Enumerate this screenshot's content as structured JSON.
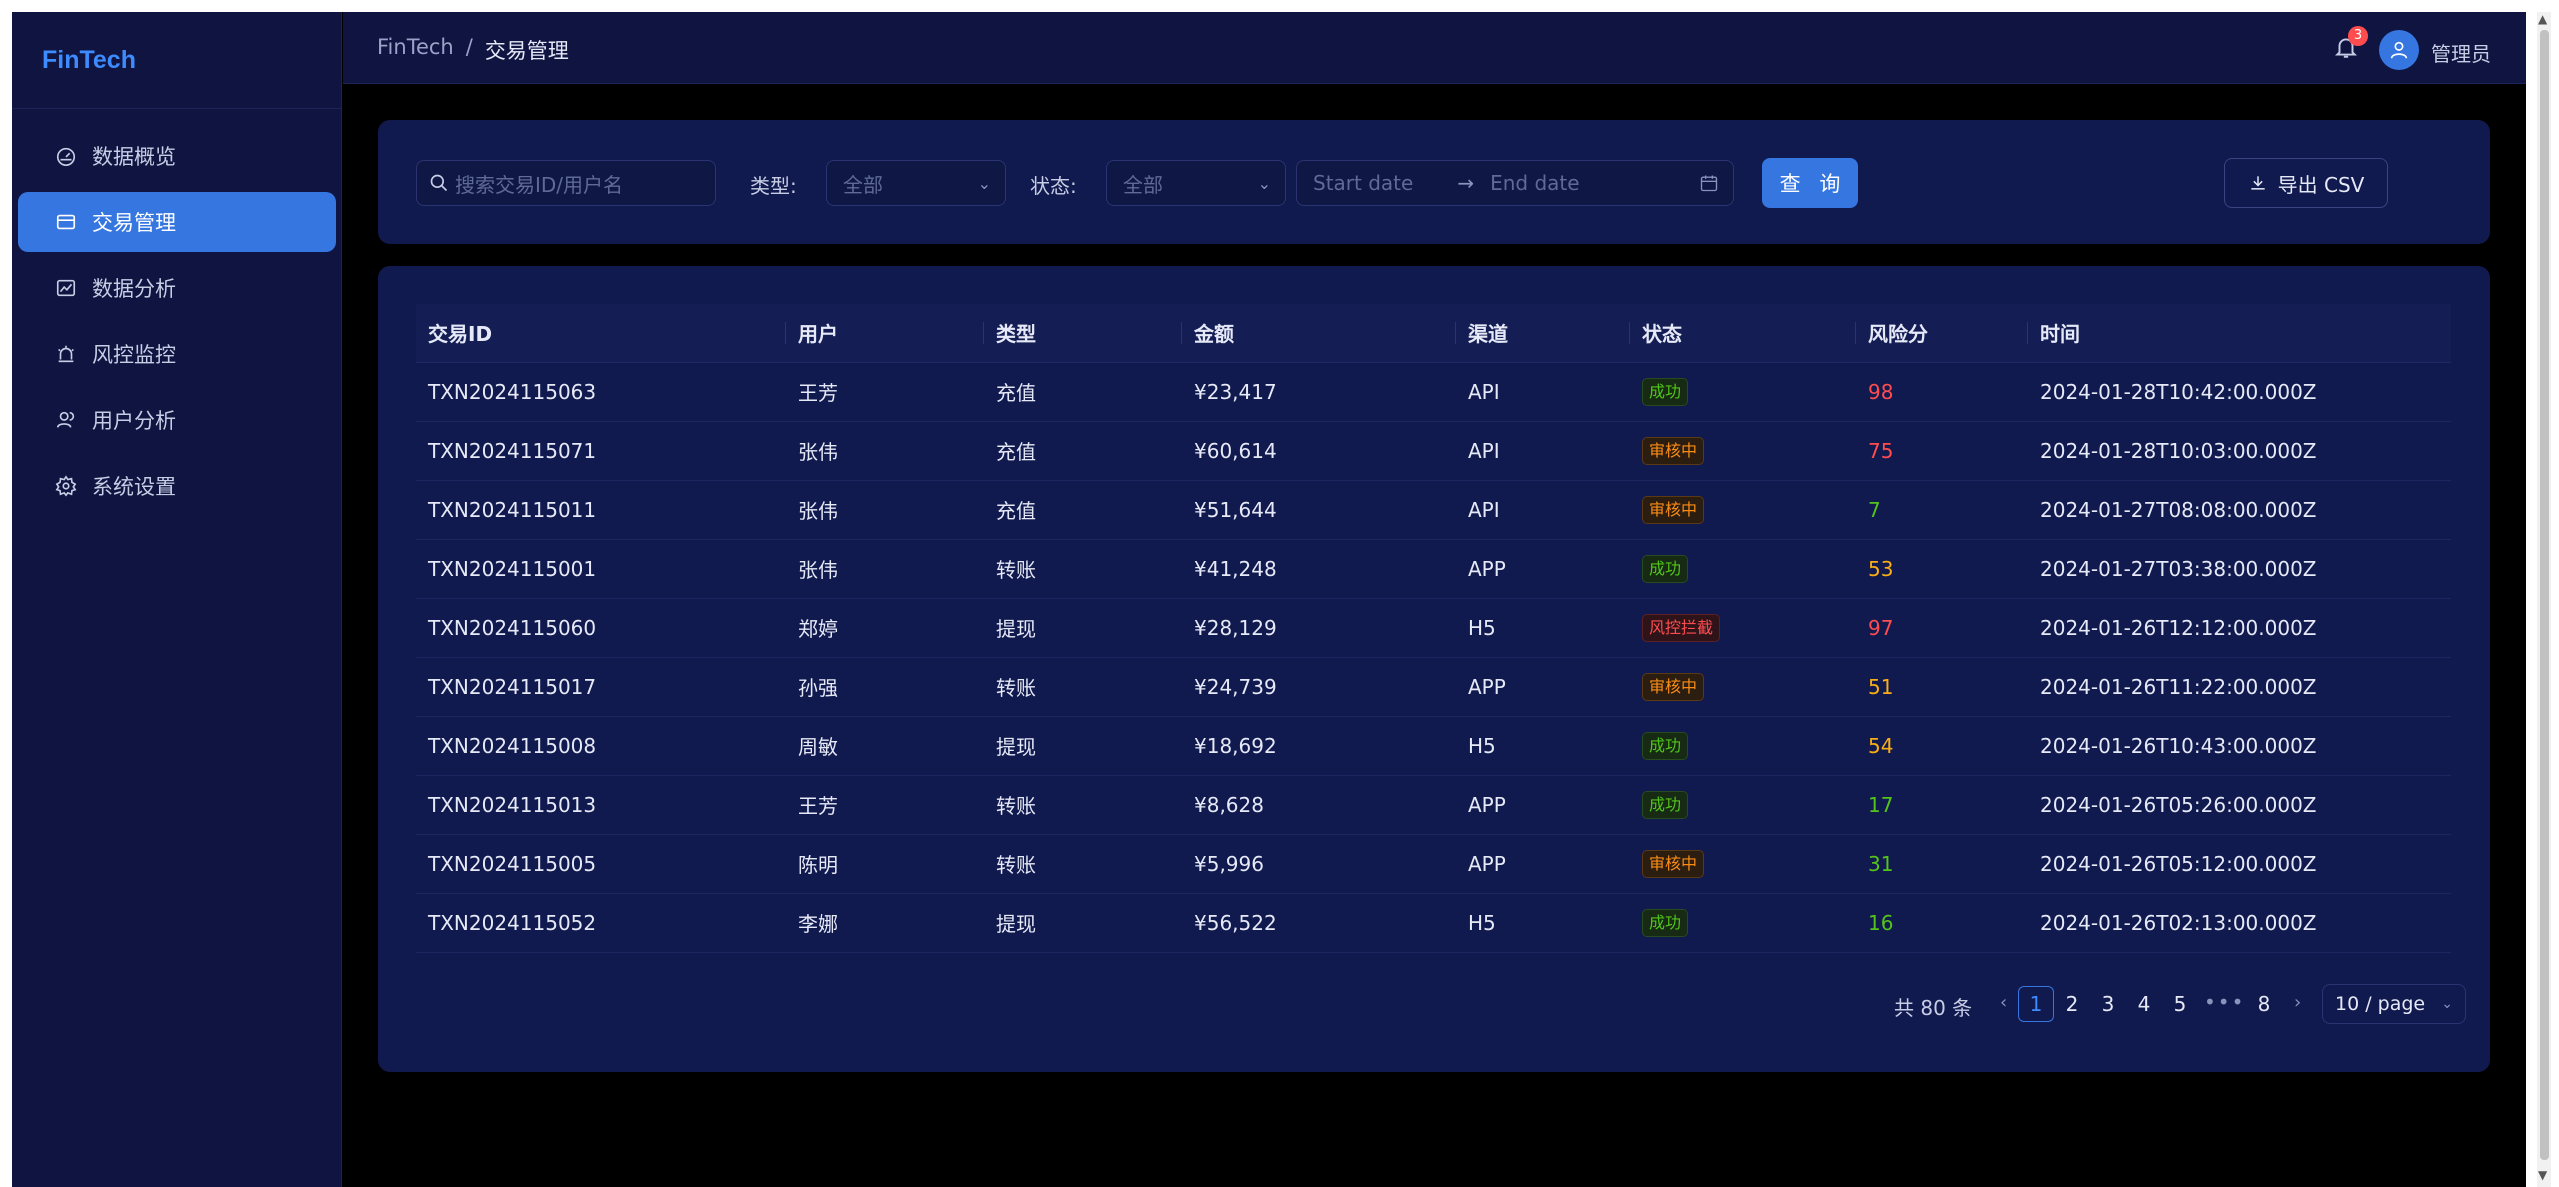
{
  "app": {
    "logo": "FinTech"
  },
  "sidebar": {
    "items": [
      {
        "label": "数据概览",
        "icon": "dashboard-icon",
        "active": false
      },
      {
        "label": "交易管理",
        "icon": "card-icon",
        "active": true
      },
      {
        "label": "数据分析",
        "icon": "line-chart-icon",
        "active": false
      },
      {
        "label": "风控监控",
        "icon": "alert-icon",
        "active": false
      },
      {
        "label": "用户分析",
        "icon": "users-icon",
        "active": false
      },
      {
        "label": "系统设置",
        "icon": "gear-icon",
        "active": false
      }
    ]
  },
  "header": {
    "breadcrumb": {
      "root": "FinTech",
      "separator": "/",
      "current": "交易管理"
    },
    "notification_count": "3",
    "username": "管理员"
  },
  "filters": {
    "search_placeholder": "搜索交易ID/用户名",
    "type_label": "类型:",
    "type_value": "全部",
    "status_label": "状态:",
    "status_value": "全部",
    "start_date_placeholder": "Start date",
    "end_date_placeholder": "End date",
    "query_button": "查 询",
    "export_button": "导出 CSV"
  },
  "table": {
    "columns": [
      "交易ID",
      "用户",
      "类型",
      "金额",
      "渠道",
      "状态",
      "风险分",
      "时间"
    ],
    "rows": [
      {
        "id": "TXN2024115063",
        "user": "王芳",
        "type": "充值",
        "amount": "¥23,417",
        "channel": "API",
        "status": "成功",
        "status_kind": "success",
        "risk": "98",
        "risk_level": "high",
        "time": "2024-01-28T10:42:00.000Z"
      },
      {
        "id": "TXN2024115071",
        "user": "张伟",
        "type": "充值",
        "amount": "¥60,614",
        "channel": "API",
        "status": "审核中",
        "status_kind": "pending",
        "risk": "75",
        "risk_level": "high",
        "time": "2024-01-28T10:03:00.000Z"
      },
      {
        "id": "TXN2024115011",
        "user": "张伟",
        "type": "充值",
        "amount": "¥51,644",
        "channel": "API",
        "status": "审核中",
        "status_kind": "pending",
        "risk": "7",
        "risk_level": "low",
        "time": "2024-01-27T08:08:00.000Z"
      },
      {
        "id": "TXN2024115001",
        "user": "张伟",
        "type": "转账",
        "amount": "¥41,248",
        "channel": "APP",
        "status": "成功",
        "status_kind": "success",
        "risk": "53",
        "risk_level": "mid",
        "time": "2024-01-27T03:38:00.000Z"
      },
      {
        "id": "TXN2024115060",
        "user": "郑婷",
        "type": "提现",
        "amount": "¥28,129",
        "channel": "H5",
        "status": "风控拦截",
        "status_kind": "blocked",
        "risk": "97",
        "risk_level": "high",
        "time": "2024-01-26T12:12:00.000Z"
      },
      {
        "id": "TXN2024115017",
        "user": "孙强",
        "type": "转账",
        "amount": "¥24,739",
        "channel": "APP",
        "status": "审核中",
        "status_kind": "pending",
        "risk": "51",
        "risk_level": "mid",
        "time": "2024-01-26T11:22:00.000Z"
      },
      {
        "id": "TXN2024115008",
        "user": "周敏",
        "type": "提现",
        "amount": "¥18,692",
        "channel": "H5",
        "status": "成功",
        "status_kind": "success",
        "risk": "54",
        "risk_level": "mid",
        "time": "2024-01-26T10:43:00.000Z"
      },
      {
        "id": "TXN2024115013",
        "user": "王芳",
        "type": "转账",
        "amount": "¥8,628",
        "channel": "APP",
        "status": "成功",
        "status_kind": "success",
        "risk": "17",
        "risk_level": "low",
        "time": "2024-01-26T05:26:00.000Z"
      },
      {
        "id": "TXN2024115005",
        "user": "陈明",
        "type": "转账",
        "amount": "¥5,996",
        "channel": "APP",
        "status": "审核中",
        "status_kind": "pending",
        "risk": "31",
        "risk_level": "low",
        "time": "2024-01-26T05:12:00.000Z"
      },
      {
        "id": "TXN2024115052",
        "user": "李娜",
        "type": "提现",
        "amount": "¥56,522",
        "channel": "H5",
        "status": "成功",
        "status_kind": "success",
        "risk": "16",
        "risk_level": "low",
        "time": "2024-01-26T02:13:00.000Z"
      }
    ]
  },
  "pagination": {
    "total": "共 80 条",
    "pages": [
      "1",
      "2",
      "3",
      "4",
      "5",
      "8"
    ],
    "current": "1",
    "ellipsis": "•••",
    "page_size": "10 / page"
  },
  "colors": {
    "accent": "#3576e0",
    "success": "#52c41a",
    "warning": "#fa8c16",
    "danger": "#ff4d4f",
    "risk_mid": "#faad14"
  }
}
